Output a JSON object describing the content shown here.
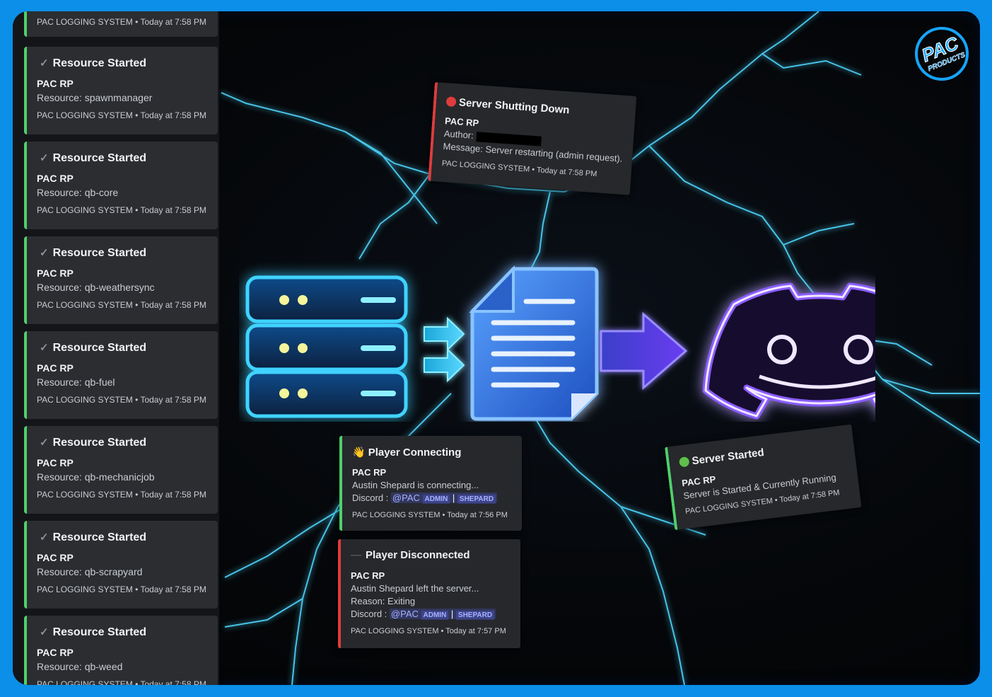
{
  "sidebar": {
    "top_footer": "PAC LOGGING SYSTEM • Today at 7:58 PM",
    "cards": [
      {
        "title": "Resource Started",
        "server": "PAC RP",
        "resource": "Resource: spawnmanager",
        "footer": "PAC LOGGING SYSTEM • Today at 7:58 PM"
      },
      {
        "title": "Resource Started",
        "server": "PAC RP",
        "resource": "Resource: qb-core",
        "footer": "PAC LOGGING SYSTEM • Today at 7:58 PM"
      },
      {
        "title": "Resource Started",
        "server": "PAC RP",
        "resource": "Resource: qb-weathersync",
        "footer": "PAC LOGGING SYSTEM • Today at 7:58 PM"
      },
      {
        "title": "Resource Started",
        "server": "PAC RP",
        "resource": "Resource: qb-fuel",
        "footer": "PAC LOGGING SYSTEM • Today at 7:58 PM"
      },
      {
        "title": "Resource Started",
        "server": "PAC RP",
        "resource": "Resource: qb-mechanicjob",
        "footer": "PAC LOGGING SYSTEM • Today at 7:58 PM"
      },
      {
        "title": "Resource Started",
        "server": "PAC RP",
        "resource": "Resource: qb-scrapyard",
        "footer": "PAC LOGGING SYSTEM • Today at 7:58 PM"
      },
      {
        "title": "Resource Started",
        "server": "PAC RP",
        "resource": "Resource: qb-weed",
        "footer": "PAC LOGGING SYSTEM • Today at 7:58 PM"
      }
    ]
  },
  "shutdown": {
    "title": "Server Shutting Down",
    "server": "PAC RP",
    "author_label": "Author:",
    "message": "Message: Server restarting (admin request).",
    "footer": "PAC LOGGING SYSTEM • Today at 7:58 PM",
    "accent": "#e03c3c"
  },
  "connecting": {
    "title": "Player Connecting",
    "server": "PAC RP",
    "line": "Austin Shepard is connecting...",
    "discord_label": "Discord :",
    "mention": "@PAC",
    "badge1": "ADMIN",
    "badge2": "SHEPARD",
    "footer": "PAC LOGGING SYSTEM • Today at 7:56 PM",
    "accent": "#4fd06b"
  },
  "disconnected": {
    "title": "Player Disconnected",
    "server": "PAC RP",
    "line": "Austin Shepard left the server...",
    "reason": "Reason: Exiting",
    "discord_label": "Discord :",
    "mention": "@PAC",
    "badge1": "ADMIN",
    "badge2": "SHEPARD",
    "footer": "PAC LOGGING SYSTEM • Today at 7:57 PM",
    "accent": "#e03c3c"
  },
  "started": {
    "title": "Server Started",
    "server": "PAC RP",
    "line": "Server is Started & Currently Running",
    "footer": "PAC LOGGING SYSTEM • Today at 7:58 PM",
    "accent": "#4fd06b"
  },
  "logo": {
    "line1": "PAC",
    "line2": "PRODUCTS",
    "color": "#16a4ff"
  },
  "icons": [
    "server-stack-icon",
    "arrow-icon",
    "document-icon",
    "discord-icon"
  ]
}
